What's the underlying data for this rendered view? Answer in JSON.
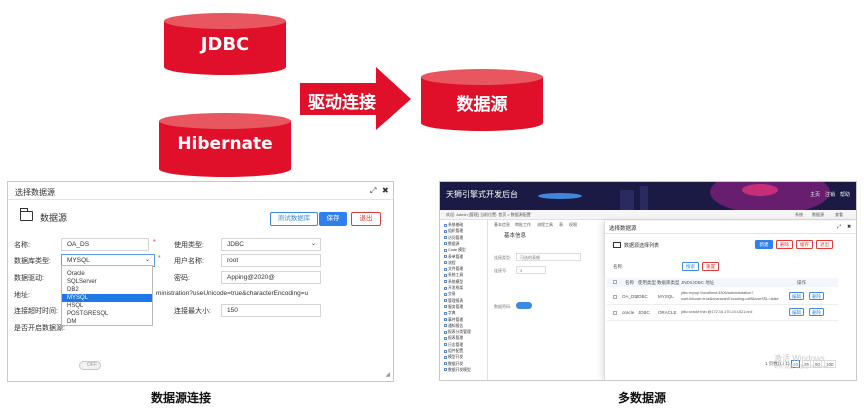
{
  "diagram": {
    "cyl_top_label": "JDBC",
    "cyl_bottom_label": "Hibernate",
    "arrow_label": "驱动连接",
    "cyl_right_label": "数据源",
    "cyl_color": "#e0102a",
    "cyl_top_color": "#e8575f"
  },
  "left_dialog": {
    "window_title": "选择数据源",
    "maximize_glyph": "⤢",
    "close_glyph": "✖",
    "header_title": "数据源",
    "btn_test": "测试数据库",
    "btn_save": "保存",
    "btn_exit": "退出",
    "label_name": "名称:",
    "value_name": "OA_DS",
    "label_usage": "使用类型:",
    "value_usage": "JDBC",
    "label_dbtype": "数据库类型:",
    "value_dbtype": "MYSQL",
    "label_user": "用户名称:",
    "value_user": "root",
    "label_driver": "数据驱动:",
    "label_password": "密码:",
    "value_password": "Apping@2020@",
    "label_address": "地址:",
    "value_address_tail": "ministration?useUnicode=true&characterEncoding=u",
    "label_conn_timeout": "连接超时时间:",
    "label_max_conn": "连接最大小:",
    "value_max_conn": "150",
    "label_default": "是否开启数据源:",
    "toggle_text": "OFF",
    "dropdown_options": [
      "Oracle",
      "SQLServer",
      "DB2",
      "MYSQL",
      "HSQL",
      "POSTGRESQL",
      "DM"
    ],
    "dropdown_selected_index": 3
  },
  "right_app": {
    "app_title": "天狮引擎式开发后台",
    "top_nav": [
      "主页",
      "注销",
      "帮助"
    ],
    "subbar_text": "欢迎: Admin [管理] 当前位置: 首页 > 数据源配置",
    "subbar_right": [
      "系统",
      "数据源",
      "查看"
    ],
    "sidebar_items": [
      "系统基础",
      "组织管理",
      "访问管理",
      "数据源",
      "Code 模型",
      "表单管理",
      "流程",
      "文件管理",
      "系统工具",
      "系统模型",
      "开发框架",
      "交易",
      "管理报表",
      "服务管理",
      "字典",
      "事件管理",
      "通知报告",
      "报表分类管理",
      "报表管理",
      "日志管理",
      "组件配置",
      "模型开发",
      "数据开发",
      "数据开发模型"
    ],
    "tabs": [
      "基本信息",
      "审批工作",
      "流程工具",
      "表",
      "权限"
    ],
    "inner_panel_title": "基本信息",
    "inner_label_1": "连接类型:",
    "inner_value_1": "可选的表格",
    "inner_label_2": "连接号:",
    "inner_value_2": "3",
    "inner_label_3": "数据密码:",
    "modal": {
      "title": "选择数据源",
      "max_glyph": "⤢",
      "close_glyph": "✖",
      "header": "数据源选择列表",
      "btn_new": "新建",
      "btn_delete": "删除",
      "btn_default": "缓存",
      "btn_exit": "退出",
      "search_label": "名称:",
      "btn_search": "搜索",
      "btn_reset": "重置",
      "columns": [
        "名称",
        "使用类型",
        "数据库类型",
        "JNDI/JDBC 地址",
        "操作"
      ],
      "rows": [
        {
          "name": "OA_DS",
          "usage": "JDBC",
          "dbtype": "MYSQL",
          "addr1": "jdbc:mysql://localhost:3306/administration?",
          "addr2": "useUnicode=true&characterEncoding=utf8&useSSL=false",
          "op1": "编辑",
          "op2": "删除"
        },
        {
          "name": "oracle",
          "usage": "JDBC",
          "dbtype": "ORACLE",
          "addr1": "jdbc:oracle:thin:@172.16.170.24:1521:orcl",
          "addr2": "",
          "op1": "编辑",
          "op2": "删除"
        }
      ],
      "pagination": [
        "1 页数(1 / 1)",
        "10",
        "25",
        "50",
        "100"
      ],
      "watermark_title": "激活 Windows",
      "watermark_sub": "转到\"设置\"以激活 Windows。"
    }
  },
  "captions": {
    "left": "数据源连接",
    "right": "多数据源"
  }
}
